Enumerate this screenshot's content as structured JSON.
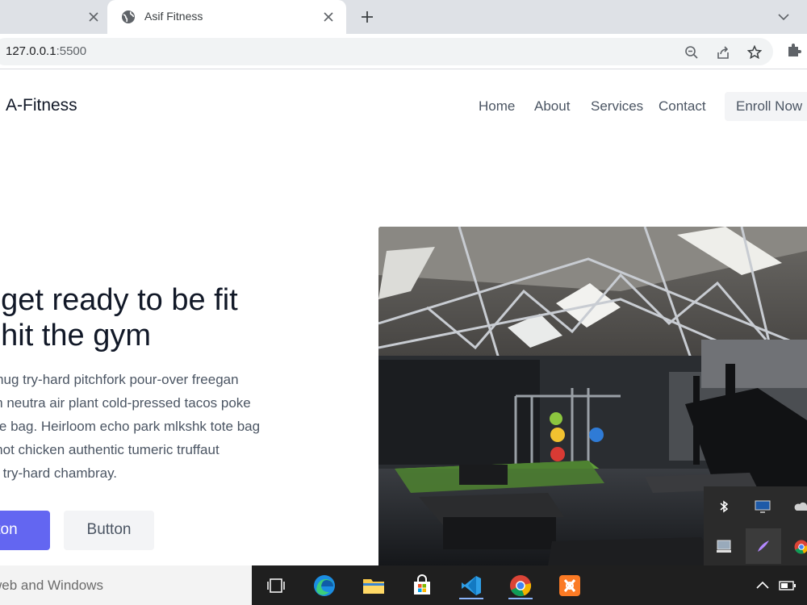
{
  "browser": {
    "tabs": [
      {
        "title": "",
        "active": false
      },
      {
        "title": "Asif Fitness",
        "active": true
      }
    ],
    "url_host": "127.0.0.1",
    "url_port": ":5500",
    "icons": [
      "globe-icon",
      "close-icon",
      "plus-icon",
      "chevron-down-icon",
      "zoom-icon",
      "share-icon",
      "star-icon",
      "puzzle-icon"
    ]
  },
  "site": {
    "logo": "A-Fitness",
    "nav": [
      "Home",
      "About",
      "Services",
      "Contact"
    ],
    "cta": "Enroll Now",
    "hero": {
      "title_lines": [
        "ts get ready to be fit",
        "ts hit the gym"
      ],
      "text_lines": [
        "r mug try-hard pitchfork pour-over freegan",
        "om neutra air plant cold-pressed tacos poke",
        "tote bag. Heirloom echo park mlkshk tote bag",
        "e hot chicken authentic tumeric truffaut",
        "on try-hard chambray."
      ],
      "primary_button": "tton",
      "secondary_button": "Button",
      "image_alt": "gym interior"
    },
    "colors": {
      "accent": "#6366f1",
      "heading": "#111827",
      "body": "#4b5563"
    }
  },
  "taskbar": {
    "search_text": "web and Windows",
    "apps": [
      "task-view",
      "edge",
      "file-explorer",
      "microsoft-store",
      "vs-code",
      "chrome",
      "xampp"
    ],
    "tray_icons": [
      "bluetooth",
      "display",
      "onedrive",
      "screen",
      "pen",
      "chrome"
    ]
  }
}
